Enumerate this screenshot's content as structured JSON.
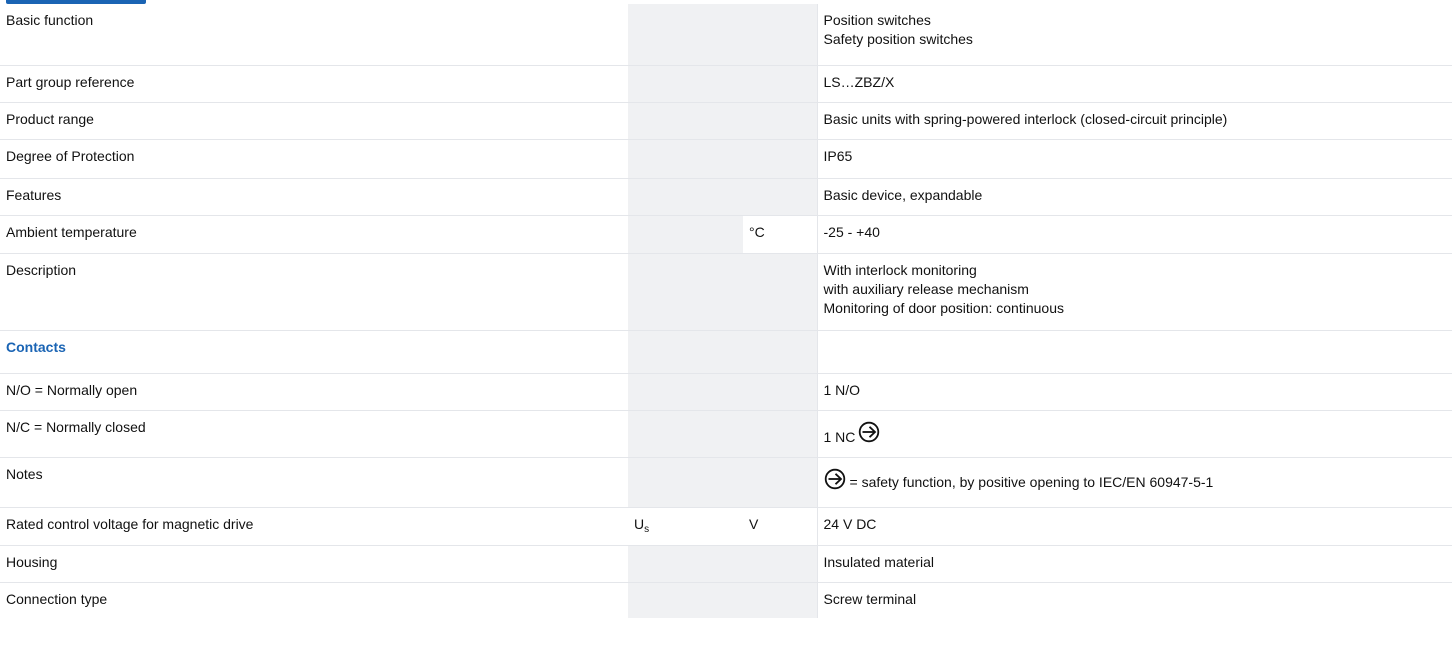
{
  "rows": [
    {
      "label": "Basic function",
      "symbol": "",
      "unit": "",
      "values": [
        "Position switches",
        "Safety position switches"
      ]
    },
    {
      "label": "Part group reference",
      "symbol": "",
      "unit": "",
      "values": [
        "LS…ZBZ/X"
      ]
    },
    {
      "label": "Product range",
      "symbol": "",
      "unit": "",
      "values": [
        "Basic units with spring-powered interlock (closed-circuit principle)"
      ]
    },
    {
      "label": "Degree of Protection",
      "symbol": "",
      "unit": "",
      "values": [
        "IP65"
      ]
    },
    {
      "label": "Features",
      "symbol": "",
      "unit": "",
      "values": [
        "Basic device, expandable"
      ]
    },
    {
      "label": "Ambient temperature",
      "symbol": "",
      "unit": "°C",
      "values": [
        "-25 - +40"
      ]
    },
    {
      "label": "Description",
      "symbol": "",
      "unit": "",
      "values": [
        "With interlock monitoring",
        "with auxiliary release mechanism",
        "Monitoring of door position: continuous"
      ]
    }
  ],
  "contacts": {
    "heading": "Contacts",
    "no_label": "N/O = Normally open",
    "no_value": "1 N/O",
    "nc_label": "N/C = Normally closed",
    "nc_value": "1 NC",
    "notes_label": "Notes",
    "notes_value": "= safety function, by positive opening to IEC/EN 60947-5-1",
    "icon": "positive-opening-arrow-circle-icon"
  },
  "rows_after": [
    {
      "label": "Rated control voltage for magnetic drive",
      "symbol_main": "U",
      "symbol_sub": "s",
      "unit": "V",
      "values": [
        "24 V DC"
      ]
    },
    {
      "label": "Housing",
      "values": [
        "Insulated material"
      ]
    },
    {
      "label": "Connection type",
      "values": [
        "Screw terminal"
      ]
    }
  ],
  "colors": {
    "accent": "#1a64b4",
    "shade": "#f0f1f3",
    "border": "#e4e6ea"
  }
}
